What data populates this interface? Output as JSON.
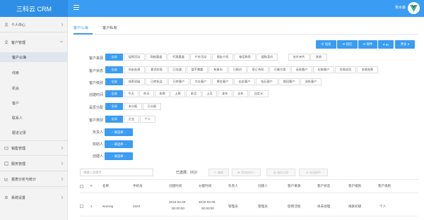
{
  "app": {
    "brand": "三科云 CRM",
    "username": "吴水森"
  },
  "sidebar": {
    "groups": [
      {
        "label": "个人中心",
        "icon": "user-icon"
      },
      {
        "label": "客户管理",
        "icon": "user-icon"
      },
      {
        "label": "销售管理",
        "icon": "cart-icon"
      },
      {
        "label": "服务管理",
        "icon": "service-icon"
      },
      {
        "label": "报表分析与统计",
        "icon": "chart-icon"
      },
      {
        "label": "系统设置",
        "icon": "gear-icon"
      }
    ],
    "sub_items": [
      "客户公海",
      "线索",
      "机会",
      "客户",
      "联系人",
      "跟进记录"
    ]
  },
  "tabs": [
    "客户公海",
    "客户私有"
  ],
  "toolbar": [
    "电话",
    "短信",
    "邮件",
    "BI",
    "更多"
  ],
  "filters": {
    "labels": [
      "客户来源",
      "客户状态",
      "客户级别",
      "创建时间",
      "是否分配",
      "客户类别",
      "负责人",
      "协助人",
      "创建人"
    ],
    "source": [
      "全部",
      "促销活动",
      "网络渠道",
      "代理渠道",
      "户外活动",
      "朋友介绍",
      "电话联系",
      "搜狗竞价",
      "名片夹片",
      "其他"
    ],
    "status": [
      "全部",
      "尚未处理",
      "意识阶段",
      "已沟通",
      "暂不需要",
      "有意向",
      "已报价",
      "签订合同",
      "已做方案",
      "无效客户",
      "拉取客户",
      "交易成功",
      "交易失败"
    ],
    "level": [
      "全部",
      "线索初级",
      "已转机会",
      "已转客户",
      "大众客户",
      "黄金客户",
      "白金客户",
      "钻石客户",
      "挽回客户",
      "流失客户"
    ],
    "time": [
      "全部",
      "今天",
      "昨天",
      "本周",
      "上周",
      "本月",
      "上月",
      "本年",
      "去年",
      "自定义"
    ],
    "assigned": [
      "全部",
      "未分配",
      "已分配"
    ],
    "category": [
      "全部",
      "企业",
      "个人"
    ],
    "select_label": "-- 请选择 --"
  },
  "list": {
    "search_placeholder": "请输入关键字",
    "selected_label": "已选择：",
    "selected_count": "0/10",
    "actions": [
      "编辑",
      "添加协作人",
      "服务记录",
      "发送邮件"
    ],
    "headers": [
      "#",
      "名称",
      "手机号",
      "创建时间",
      "分配时间",
      "负责人",
      "创建人",
      "客户来源",
      "客户状态",
      "客户级别",
      "客户类别"
    ],
    "rows": [
      {
        "index": "1",
        "name": "wurong",
        "phone": "2323",
        "created": [
          "2018-04-26",
          "00:00:00"
        ],
        "assigned": [
          "2018-03-05",
          "00:00:00"
        ],
        "owner": "管理员",
        "creator": "管理员",
        "source": "促销活动",
        "status": "尚未处理",
        "level": "线索初级",
        "category": "个人"
      }
    ]
  },
  "colors": {
    "primary": "#3a9cf2",
    "brand_bar": "#2f8fe6",
    "sidebar_bg": "#f3f3f3"
  }
}
